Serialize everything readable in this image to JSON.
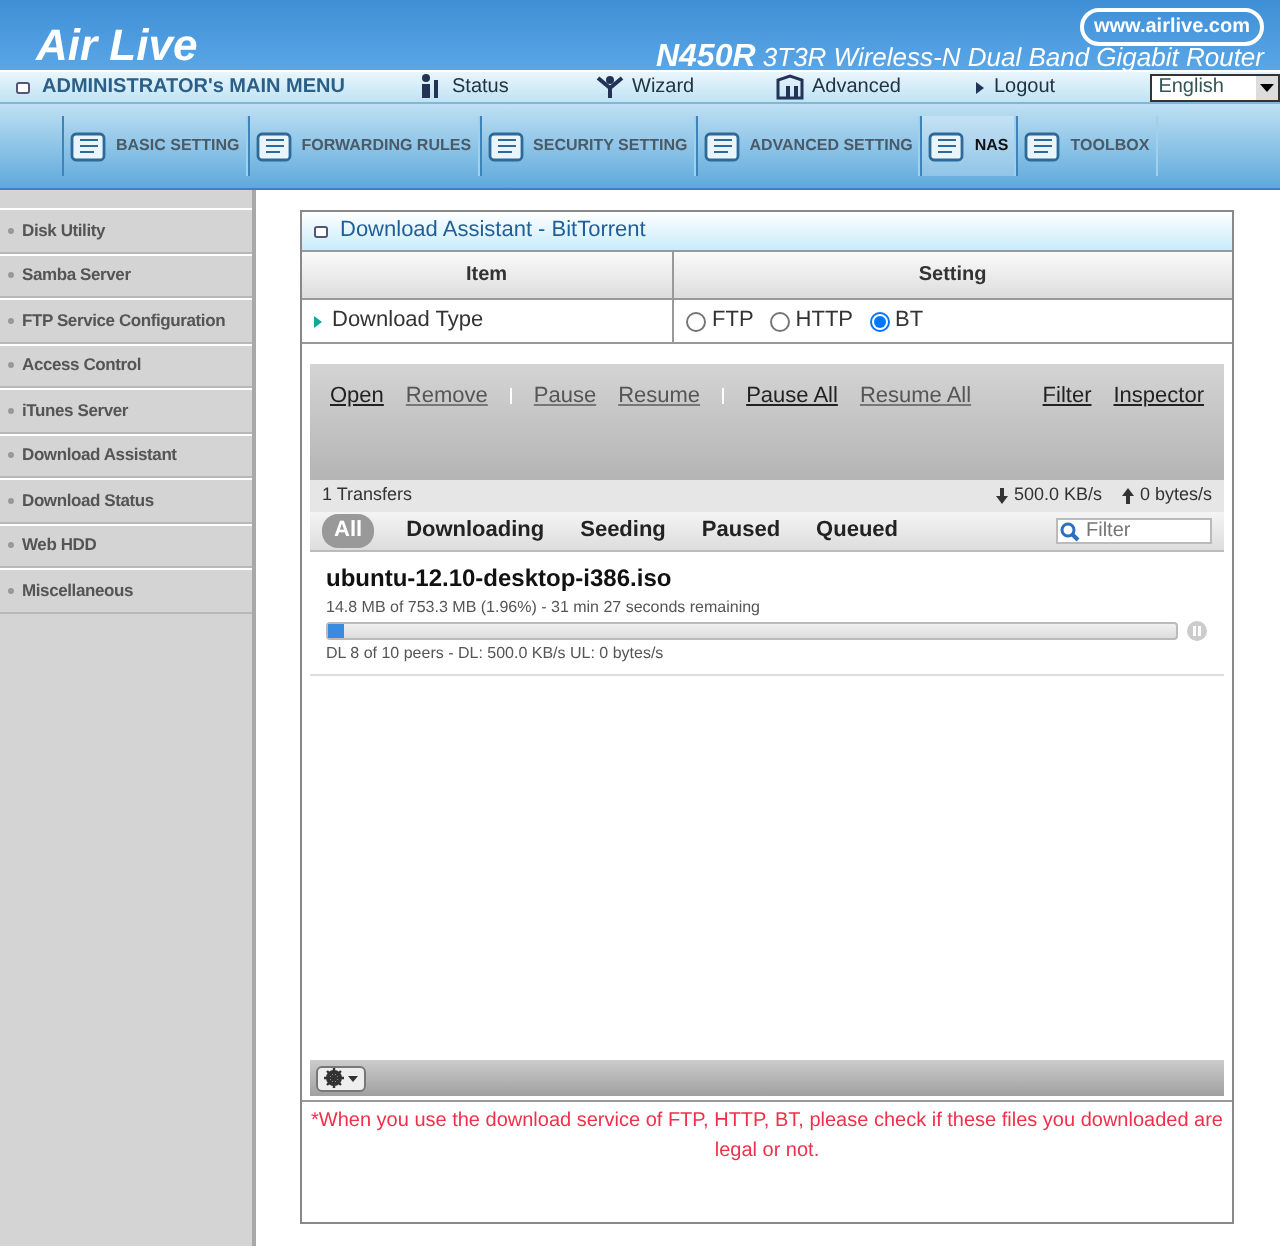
{
  "header": {
    "logo": "Air Live",
    "url": "www.airlive.com",
    "model": "N450R",
    "subtitle": "3T3R Wireless-N Dual Band Gigabit Router"
  },
  "menu_bar": {
    "title": "ADMINISTRATOR's MAIN MENU",
    "links": [
      {
        "label": "Status",
        "kind": "status"
      },
      {
        "label": "Wizard",
        "kind": "wizard"
      },
      {
        "label": "Advanced",
        "kind": "advanced"
      },
      {
        "label": "Logout",
        "kind": "logout"
      }
    ],
    "language": "English"
  },
  "tabs": [
    {
      "label": "BASIC SETTING",
      "selected": false
    },
    {
      "label": "FORWARDING RULES",
      "selected": false
    },
    {
      "label": "SECURITY SETTING",
      "selected": false
    },
    {
      "label": "ADVANCED SETTING",
      "selected": false
    },
    {
      "label": "NAS",
      "selected": true
    },
    {
      "label": "TOOLBOX",
      "selected": false
    }
  ],
  "sidebar": {
    "items": [
      "Disk Utility",
      "Samba Server",
      "FTP Service Configuration",
      "Access Control",
      "iTunes Server",
      "Download Assistant",
      "Download Status",
      "Web HDD",
      "Miscellaneous"
    ]
  },
  "panel": {
    "title": "Download Assistant - BitTorrent",
    "columns": [
      "Item",
      "Setting"
    ],
    "row_label": "Download Type",
    "options": [
      {
        "label": "FTP",
        "selected": false
      },
      {
        "label": "HTTP",
        "selected": false
      },
      {
        "label": "BT",
        "selected": true
      }
    ]
  },
  "torrent": {
    "toolbar": [
      {
        "label": "Open",
        "disabled": false
      },
      {
        "label": "Remove",
        "disabled": true
      },
      {
        "label": "Pause",
        "disabled": true
      },
      {
        "label": "Resume",
        "disabled": true
      },
      {
        "label": "Pause All",
        "disabled": false
      },
      {
        "label": "Resume All",
        "disabled": true
      }
    ],
    "toolbar_right": [
      "Filter",
      "Inspector"
    ],
    "transfers": "1 Transfers",
    "down_speed": "500.0 KB/s",
    "up_speed": "0 bytes/s",
    "filters": [
      {
        "label": "All",
        "selected": true
      },
      {
        "label": "Downloading",
        "selected": false
      },
      {
        "label": "Seeding",
        "selected": false
      },
      {
        "label": "Paused",
        "selected": false
      },
      {
        "label": "Queued",
        "selected": false
      }
    ],
    "filter_placeholder": "Filter",
    "items": [
      {
        "name": "ubuntu-12.10-desktop-i386.iso",
        "progress": "14.8 MB of 753.3 MB (1.96%) - 31 min 27 seconds remaining",
        "level": 0.0196,
        "peers": "DL 8 of 10 peers - DL: 500.0 KB/s UL: 0 bytes/s"
      }
    ]
  },
  "notice": "*When you use the download service of FTP, HTTP, BT, please check if these files you downloaded are legal or not."
}
